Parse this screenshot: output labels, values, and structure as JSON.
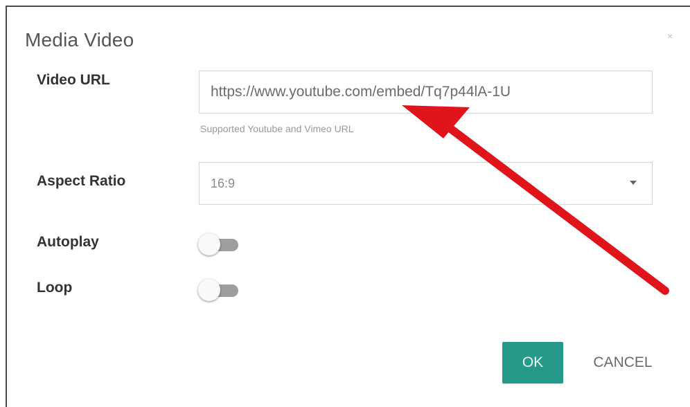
{
  "dialog": {
    "title": "Media Video",
    "close_label": "×"
  },
  "fields": {
    "video_url": {
      "label": "Video URL",
      "value": "https://www.youtube.com/embed/Tq7p44lA-1U",
      "hint": "Supported Youtube and Vimeo URL"
    },
    "aspect_ratio": {
      "label": "Aspect Ratio",
      "value": "16:9"
    },
    "autoplay": {
      "label": "Autoplay",
      "on": false
    },
    "loop": {
      "label": "Loop",
      "on": false
    }
  },
  "buttons": {
    "ok": "OK",
    "cancel": "CANCEL"
  },
  "colors": {
    "accent": "#26998a",
    "annotation_arrow": "#e0141b"
  }
}
